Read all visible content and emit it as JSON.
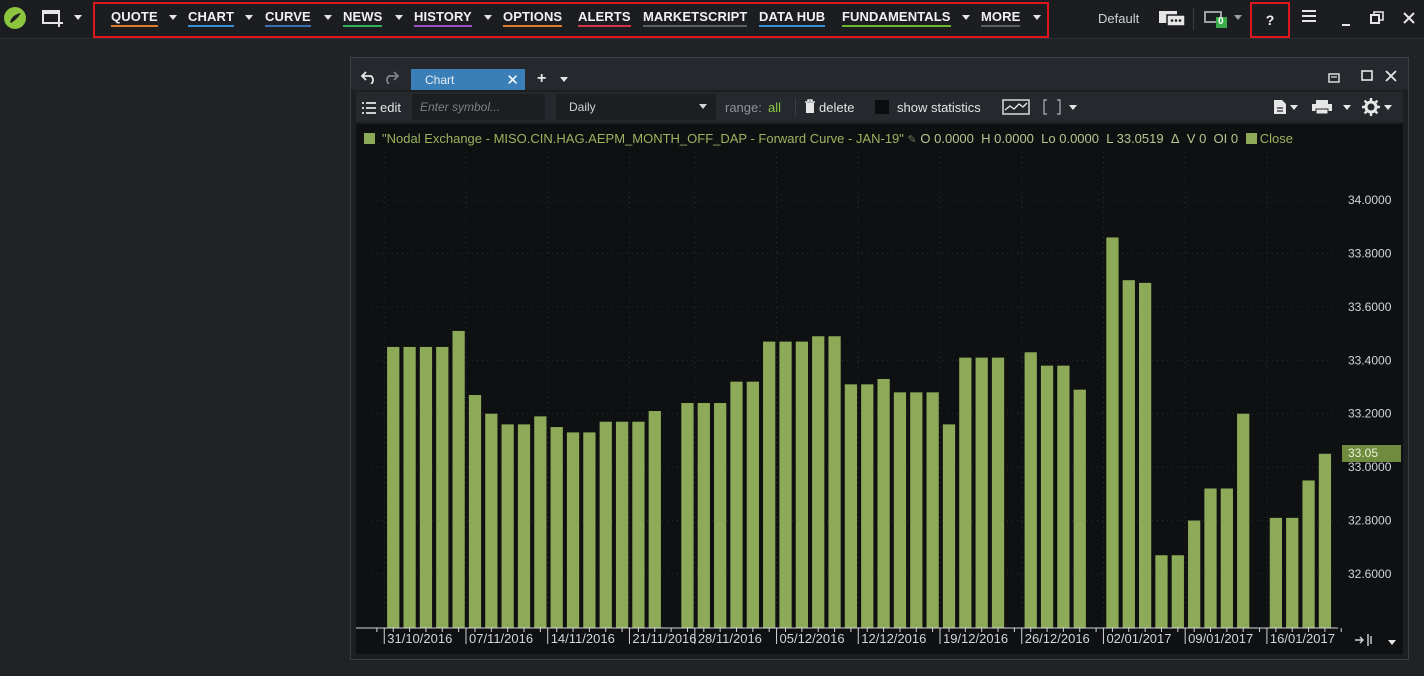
{
  "topbar": {
    "nav": [
      {
        "label": "QUOTE",
        "underline": "#e07a2b",
        "caret": true
      },
      {
        "label": "CHART",
        "underline": "#3a8fd6",
        "caret": true
      },
      {
        "label": "CURVE",
        "underline": "#3a6fb0",
        "caret": true
      },
      {
        "label": "NEWS",
        "underline": "#31b05a",
        "caret": true
      },
      {
        "label": "HISTORY",
        "underline": "#9b4fc2",
        "caret": true
      },
      {
        "label": "OPTIONS",
        "underline": "#e07a2b",
        "caret": false
      },
      {
        "label": "ALERTS",
        "underline": "#d1334a",
        "caret": false
      },
      {
        "label": "MARKETSCRIPT",
        "underline": "#5a5f66",
        "caret": false
      },
      {
        "label": "DATA HUB",
        "underline": "#3a8fd6",
        "caret": false
      },
      {
        "label": "FUNDAMENTALS",
        "underline": "#6cb52e",
        "caret": true
      },
      {
        "label": "MORE",
        "underline": "#5a5f66",
        "caret": true
      }
    ],
    "workspace_label": "Default",
    "connection_badge": "0",
    "help_label": "?"
  },
  "chart_window": {
    "tab_label": "Chart",
    "toolbar": {
      "edit_label": "edit",
      "symbol_placeholder": "Enter symbol...",
      "period_value": "Daily",
      "range_label": "range:",
      "range_value": "all",
      "delete_label": "delete",
      "show_statistics_label": "show statistics"
    },
    "legend": {
      "series_name": "\"Nodal Exchange - MISO.CIN.HAG.AEPM_MONTH_OFF_DAP - Forward Curve - JAN-19\"",
      "o_label": "O",
      "o_value": "0.0000",
      "h_label": "H",
      "h_value": "0.0000",
      "lo_label": "Lo",
      "lo_value": "0.0000",
      "l_label": "L",
      "l_value": "33.0519",
      "delta_label": "Δ",
      "v_label": "V",
      "v_value": "0",
      "oi_label": "OI",
      "oi_value": "0",
      "close_label": "Close"
    },
    "last_price_label": "33.05"
  },
  "colors": {
    "bar": "#8daa58",
    "last_price_box": "#6f8c3e"
  },
  "chart_data": {
    "type": "bar",
    "ylim": [
      32.42,
      34.18
    ],
    "yticks": [
      "32.6000",
      "32.8000",
      "33.0000",
      "33.2000",
      "33.4000",
      "33.6000",
      "33.8000",
      "34.0000"
    ],
    "xticks": [
      "31/10/2016",
      "07/11/2016",
      "14/11/2016",
      "21/11/2016",
      "28/11/2016",
      "05/12/2016",
      "12/12/2016",
      "19/12/2016",
      "26/12/2016",
      "02/01/2017",
      "09/01/2017",
      "16/01/2017"
    ],
    "grid": true,
    "legend_position": "top-left",
    "values": [
      33.45,
      33.45,
      33.45,
      33.45,
      33.51,
      33.27,
      33.2,
      33.16,
      33.16,
      33.19,
      33.15,
      33.13,
      33.13,
      33.17,
      33.17,
      33.17,
      33.21,
      null,
      33.24,
      33.24,
      33.24,
      33.32,
      33.32,
      33.47,
      33.47,
      33.47,
      33.49,
      33.49,
      33.31,
      33.31,
      33.33,
      33.28,
      33.28,
      33.28,
      33.16,
      33.41,
      33.41,
      33.41,
      null,
      33.43,
      33.38,
      33.38,
      33.29,
      null,
      33.86,
      33.7,
      33.69,
      32.67,
      32.67,
      32.8,
      32.92,
      32.92,
      33.2,
      null,
      32.81,
      32.81,
      32.95,
      33.05
    ],
    "last_value": 33.05
  }
}
